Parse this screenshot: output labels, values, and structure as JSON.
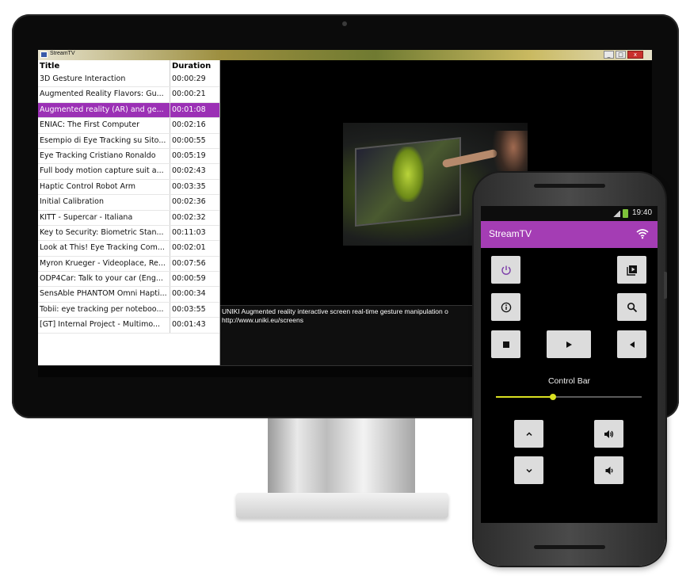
{
  "desktop": {
    "app_title": "StreamTV",
    "columns": {
      "title": "Title",
      "duration": "Duration"
    },
    "videos": [
      {
        "title": "3D Gesture Interaction",
        "duration": "00:00:29"
      },
      {
        "title": "Augmented Reality Flavors: Gu...",
        "duration": "00:00:21"
      },
      {
        "title": "Augmented reality (AR) and ge...",
        "duration": "00:01:08",
        "selected": true
      },
      {
        "title": "ENIAC: The First Computer",
        "duration": "00:02:16"
      },
      {
        "title": "Esempio di Eye Tracking su Sito...",
        "duration": "00:00:55"
      },
      {
        "title": "Eye Tracking Cristiano Ronaldo",
        "duration": "00:05:19"
      },
      {
        "title": "Full body motion capture suit a...",
        "duration": "00:02:43"
      },
      {
        "title": "Haptic Control Robot Arm",
        "duration": "00:03:35"
      },
      {
        "title": "Initial Calibration",
        "duration": "00:02:36"
      },
      {
        "title": "KITT - Supercar - Italiana",
        "duration": "00:02:32"
      },
      {
        "title": "Key to Security: Biometric Stan...",
        "duration": "00:11:03"
      },
      {
        "title": "Look at This! Eye Tracking Com...",
        "duration": "00:02:01"
      },
      {
        "title": "Myron Krueger - Videoplace, Re...",
        "duration": "00:07:56"
      },
      {
        "title": "ODP4Car: Talk to your car (Eng...",
        "duration": "00:00:59"
      },
      {
        "title": "SensAble PHANTOM Omni Hapti...",
        "duration": "00:00:34"
      },
      {
        "title": "Tobii: eye tracking per noteboo...",
        "duration": "00:03:55"
      },
      {
        "title": "[GT] Internal Project - Multimo...",
        "duration": "00:01:43"
      }
    ],
    "description_line1": "UNIKI Augmented reality interactive screen real-time gesture manipulation o",
    "description_line2": "http://www.uniki.eu/screens",
    "window_buttons": {
      "minimize": "_",
      "maximize": "□",
      "close": "x"
    }
  },
  "phone": {
    "time": "19:40",
    "app_title": "StreamTV",
    "control_bar_label": "Control Bar",
    "control_bar_value": 0.39,
    "colors": {
      "appbar": "#a43db4",
      "slider": "#d9e021",
      "selected_row": "#9b30b5"
    },
    "buttons": [
      {
        "name": "power-button",
        "icon": "power-icon"
      },
      {
        "name": "playlist-button",
        "icon": "playlist-play-icon"
      },
      {
        "name": "info-button",
        "icon": "info-icon"
      },
      {
        "name": "search-button",
        "icon": "search-icon"
      },
      {
        "name": "stop-button",
        "icon": "stop-icon"
      },
      {
        "name": "play-button",
        "icon": "play-icon"
      },
      {
        "name": "rewind-button",
        "icon": "previous-icon"
      },
      {
        "name": "channel-up-button",
        "icon": "chevron-up-icon"
      },
      {
        "name": "volume-up-button",
        "icon": "volume-up-icon"
      },
      {
        "name": "channel-down-button",
        "icon": "chevron-down-icon"
      },
      {
        "name": "volume-down-button",
        "icon": "volume-down-icon"
      }
    ]
  }
}
